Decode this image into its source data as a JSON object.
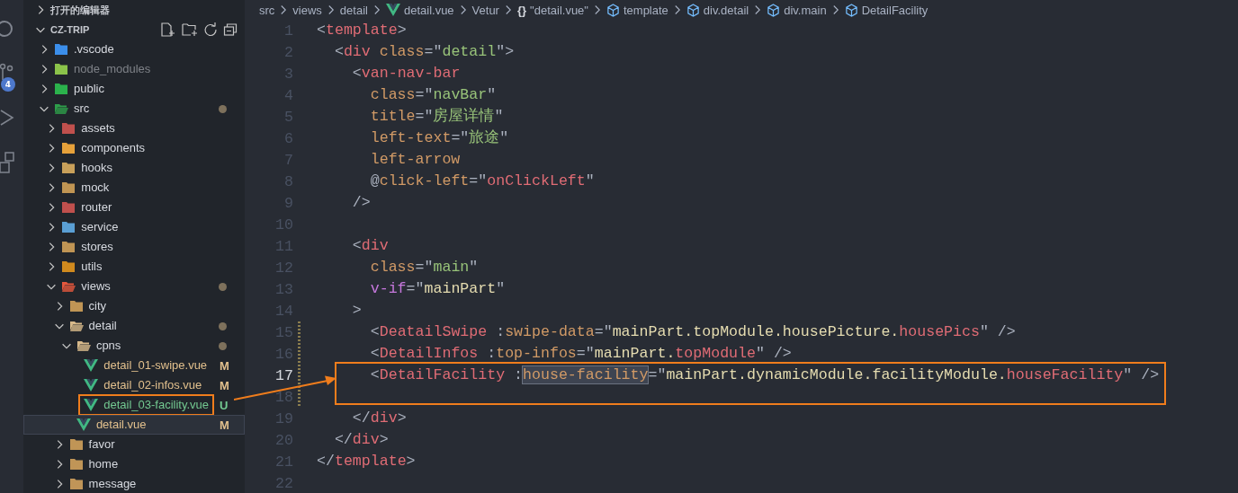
{
  "activity_bar": {
    "badge": "4"
  },
  "explorer": {
    "open_editors": {
      "label": "打开的编辑器",
      "expanded": false
    },
    "project": {
      "label": "CZ-TRIP",
      "expanded": true
    },
    "items": [
      {
        "name": ".vscode",
        "kind": "folder",
        "expanded": false,
        "selected": false,
        "boxed": false,
        "modified": false,
        "ignored": false,
        "color": "#3b8eea"
      },
      {
        "name": "node_modules",
        "kind": "folder",
        "expanded": false,
        "selected": false,
        "boxed": false,
        "modified": false,
        "ignored": true,
        "color": "#8bc34a"
      },
      {
        "name": "public",
        "kind": "folder",
        "expanded": false,
        "selected": false,
        "boxed": false,
        "modified": false,
        "ignored": false,
        "color": "#2bb24c"
      },
      {
        "name": "src",
        "kind": "folder",
        "expanded": true,
        "selected": false,
        "boxed": false,
        "modified": true,
        "ignored": false,
        "color": "#2e9e4a",
        "children": [
          {
            "name": "assets",
            "kind": "folder",
            "expanded": false,
            "selected": false,
            "boxed": false,
            "modified": false,
            "ignored": false,
            "color": "#c0504d"
          },
          {
            "name": "components",
            "kind": "folder",
            "expanded": false,
            "selected": false,
            "boxed": false,
            "modified": false,
            "ignored": false,
            "color": "#e6a13a"
          },
          {
            "name": "hooks",
            "kind": "folder",
            "expanded": false,
            "selected": false,
            "boxed": false,
            "modified": false,
            "ignored": false,
            "color": "#c8a05a"
          },
          {
            "name": "mock",
            "kind": "folder",
            "expanded": false,
            "selected": false,
            "boxed": false,
            "modified": false,
            "ignored": false,
            "color": "#c09553"
          },
          {
            "name": "router",
            "kind": "folder",
            "expanded": false,
            "selected": false,
            "boxed": false,
            "modified": false,
            "ignored": false,
            "color": "#c0504d"
          },
          {
            "name": "service",
            "kind": "folder",
            "expanded": false,
            "selected": false,
            "boxed": false,
            "modified": false,
            "ignored": false,
            "color": "#5a9fd4"
          },
          {
            "name": "stores",
            "kind": "folder",
            "expanded": false,
            "selected": false,
            "boxed": false,
            "modified": false,
            "ignored": false,
            "color": "#c09554"
          },
          {
            "name": "utils",
            "kind": "folder",
            "expanded": false,
            "selected": false,
            "boxed": false,
            "modified": false,
            "ignored": false,
            "color": "#d08a1e"
          },
          {
            "name": "views",
            "kind": "folder",
            "expanded": true,
            "selected": false,
            "boxed": false,
            "modified": true,
            "ignored": false,
            "color": "#e4573d",
            "children": [
              {
                "name": "city",
                "kind": "folder",
                "expanded": false,
                "selected": false,
                "boxed": false,
                "modified": false,
                "ignored": false,
                "color": "#c09555"
              },
              {
                "name": "detail",
                "kind": "folder",
                "expanded": true,
                "selected": false,
                "boxed": false,
                "modified": true,
                "ignored": false,
                "color": "#d7b98a",
                "children": [
                  {
                    "name": "cpns",
                    "kind": "folder",
                    "expanded": true,
                    "selected": false,
                    "boxed": false,
                    "modified": true,
                    "ignored": false,
                    "color": "#d7b98b",
                    "children": [
                      {
                        "name": "detail_01-swipe.vue",
                        "kind": "file",
                        "selected": false,
                        "boxed": false,
                        "modified": true,
                        "ignored": false,
                        "untracked": false,
                        "status": "M"
                      },
                      {
                        "name": "detail_02-infos.vue",
                        "kind": "file",
                        "selected": false,
                        "boxed": false,
                        "modified": true,
                        "ignored": false,
                        "untracked": false,
                        "status": "M"
                      },
                      {
                        "name": "detail_03-facility.vue",
                        "kind": "file",
                        "selected": false,
                        "boxed": true,
                        "modified": false,
                        "ignored": false,
                        "untracked": true,
                        "status": "U"
                      }
                    ]
                  },
                  {
                    "name": "detail.vue",
                    "kind": "file",
                    "selected": true,
                    "boxed": false,
                    "modified": true,
                    "ignored": false,
                    "untracked": false,
                    "status": "M"
                  }
                ]
              },
              {
                "name": "favor",
                "kind": "folder",
                "expanded": false,
                "selected": false,
                "boxed": false,
                "modified": false,
                "ignored": false,
                "color": "#c09556"
              },
              {
                "name": "home",
                "kind": "folder",
                "expanded": false,
                "selected": false,
                "boxed": false,
                "modified": false,
                "ignored": false,
                "color": "#c09557"
              },
              {
                "name": "message",
                "kind": "folder",
                "expanded": false,
                "selected": false,
                "boxed": false,
                "modified": false,
                "ignored": false,
                "color": "#c09558"
              }
            ]
          }
        ]
      }
    ]
  },
  "breadcrumb": [
    {
      "label": "src",
      "kind": "plain"
    },
    {
      "label": "views",
      "kind": "plain"
    },
    {
      "label": "detail",
      "kind": "plain"
    },
    {
      "label": "detail.vue",
      "kind": "file"
    },
    {
      "label": "Vetur",
      "kind": "plain"
    },
    {
      "label": "\"detail.vue\"",
      "kind": "module",
      "glyph": "{}"
    },
    {
      "label": "template",
      "kind": "element"
    },
    {
      "label": "div.detail",
      "kind": "element"
    },
    {
      "label": "div.main",
      "kind": "element"
    },
    {
      "label": "DetailFacility",
      "kind": "element"
    }
  ],
  "annotations": [
    {
      "kind": "arrow"
    }
  ],
  "code": [
    {
      "n": "1",
      "current": false,
      "changed": false,
      "boxed": false,
      "tokens": [
        {
          "kind": "p",
          "t": "<"
        },
        {
          "kind": "tag",
          "t": "template"
        },
        {
          "kind": "p",
          "t": ">"
        }
      ]
    },
    {
      "n": "2",
      "current": false,
      "changed": false,
      "boxed": false,
      "tokens": [
        {
          "kind": "p",
          "t": "  <"
        },
        {
          "kind": "tag",
          "t": "div"
        },
        {
          "kind": "attr",
          "t": " class"
        },
        {
          "kind": "p",
          "t": "=\""
        },
        {
          "kind": "str",
          "t": "detail"
        },
        {
          "kind": "p",
          "t": "\">"
        }
      ]
    },
    {
      "n": "3",
      "current": false,
      "changed": false,
      "boxed": false,
      "tokens": [
        {
          "kind": "p",
          "t": "    <"
        },
        {
          "kind": "tag",
          "t": "van-nav-bar"
        }
      ]
    },
    {
      "n": "4",
      "current": false,
      "changed": false,
      "boxed": false,
      "tokens": [
        {
          "kind": "attr",
          "t": "      class"
        },
        {
          "kind": "p",
          "t": "=\""
        },
        {
          "kind": "str",
          "t": "navBar"
        },
        {
          "kind": "p",
          "t": "\""
        }
      ]
    },
    {
      "n": "5",
      "current": false,
      "changed": false,
      "boxed": false,
      "tokens": [
        {
          "kind": "attr",
          "t": "      title"
        },
        {
          "kind": "p",
          "t": "=\""
        },
        {
          "kind": "str",
          "t": "房屋详情"
        },
        {
          "kind": "p",
          "t": "\""
        }
      ]
    },
    {
      "n": "6",
      "current": false,
      "changed": false,
      "boxed": false,
      "tokens": [
        {
          "kind": "attr",
          "t": "      left-text"
        },
        {
          "kind": "p",
          "t": "=\""
        },
        {
          "kind": "str",
          "t": "旅途"
        },
        {
          "kind": "p",
          "t": "\""
        }
      ]
    },
    {
      "n": "7",
      "current": false,
      "changed": false,
      "boxed": false,
      "tokens": [
        {
          "kind": "attr",
          "t": "      left-arrow"
        }
      ]
    },
    {
      "n": "8",
      "current": false,
      "changed": false,
      "boxed": false,
      "tokens": [
        {
          "kind": "p",
          "t": "      @"
        },
        {
          "kind": "attr",
          "t": "click-left"
        },
        {
          "kind": "p",
          "t": "=\""
        },
        {
          "kind": "ref",
          "t": "onClickLeft"
        },
        {
          "kind": "p",
          "t": "\""
        }
      ]
    },
    {
      "n": "9",
      "current": false,
      "changed": false,
      "boxed": false,
      "tokens": [
        {
          "kind": "p",
          "t": "    />"
        }
      ]
    },
    {
      "n": "10",
      "current": false,
      "changed": false,
      "boxed": false
    },
    {
      "n": "11",
      "current": false,
      "changed": false,
      "boxed": false,
      "tokens": [
        {
          "kind": "p",
          "t": "    <"
        },
        {
          "kind": "tag",
          "t": "div"
        }
      ]
    },
    {
      "n": "12",
      "current": false,
      "changed": false,
      "boxed": false,
      "tokens": [
        {
          "kind": "attr",
          "t": "      class"
        },
        {
          "kind": "p",
          "t": "=\""
        },
        {
          "kind": "str",
          "t": "main"
        },
        {
          "kind": "p",
          "t": "\""
        }
      ]
    },
    {
      "n": "13",
      "current": false,
      "changed": false,
      "boxed": false,
      "tokens": [
        {
          "kind": "dir",
          "t": "      v-if"
        },
        {
          "kind": "p",
          "t": "=\""
        },
        {
          "kind": "var",
          "t": "mainPart"
        },
        {
          "kind": "p",
          "t": "\""
        }
      ]
    },
    {
      "n": "14",
      "current": false,
      "changed": false,
      "boxed": false,
      "tokens": [
        {
          "kind": "p",
          "t": "    >"
        }
      ]
    },
    {
      "n": "15",
      "current": false,
      "changed": true,
      "boxed": false,
      "tokens": [
        {
          "kind": "p",
          "t": "      <"
        },
        {
          "kind": "tag",
          "t": "DeatailSwipe"
        },
        {
          "kind": "p",
          "t": " :"
        },
        {
          "kind": "attr",
          "t": "swipe-data"
        },
        {
          "kind": "p",
          "t": "=\""
        },
        {
          "kind": "var",
          "t": "mainPart.topModule.housePicture."
        },
        {
          "kind": "ref",
          "t": "housePics"
        },
        {
          "kind": "p",
          "t": "\" />"
        }
      ]
    },
    {
      "n": "16",
      "current": false,
      "changed": true,
      "boxed": false,
      "tokens": [
        {
          "kind": "p",
          "t": "      <"
        },
        {
          "kind": "tag",
          "t": "DetailInfos"
        },
        {
          "kind": "p",
          "t": " :"
        },
        {
          "kind": "attr",
          "t": "top-infos"
        },
        {
          "kind": "p",
          "t": "=\""
        },
        {
          "kind": "var",
          "t": "mainPart."
        },
        {
          "kind": "ref",
          "t": "topModule"
        },
        {
          "kind": "p",
          "t": "\" />"
        }
      ]
    },
    {
      "n": "17",
      "current": true,
      "changed": true,
      "boxed": true,
      "tokens": [
        {
          "kind": "p",
          "t": "      <"
        },
        {
          "kind": "tag",
          "t": "DetailFacility"
        },
        {
          "kind": "p",
          "t": " :"
        },
        {
          "kind": "sel",
          "t": "house-facility"
        },
        {
          "kind": "p",
          "t": "=\""
        },
        {
          "kind": "var",
          "t": "mainPart.dynamicModule.facilityModule."
        },
        {
          "kind": "ref",
          "t": "houseFacility"
        },
        {
          "kind": "p",
          "t": "\" />"
        }
      ]
    },
    {
      "n": "18",
      "current": false,
      "changed": true,
      "boxed": false
    },
    {
      "n": "19",
      "current": false,
      "changed": false,
      "boxed": false,
      "tokens": [
        {
          "kind": "p",
          "t": "    </"
        },
        {
          "kind": "tag",
          "t": "div"
        },
        {
          "kind": "p",
          "t": ">"
        }
      ]
    },
    {
      "n": "20",
      "current": false,
      "changed": false,
      "boxed": false,
      "tokens": [
        {
          "kind": "p",
          "t": "  </"
        },
        {
          "kind": "tag",
          "t": "div"
        },
        {
          "kind": "p",
          "t": ">"
        }
      ]
    },
    {
      "n": "21",
      "current": false,
      "changed": false,
      "boxed": false,
      "tokens": [
        {
          "kind": "p",
          "t": "</"
        },
        {
          "kind": "tag",
          "t": "template"
        },
        {
          "kind": "p",
          "t": ">"
        }
      ]
    },
    {
      "n": "22",
      "current": false,
      "changed": false,
      "boxed": false
    }
  ]
}
